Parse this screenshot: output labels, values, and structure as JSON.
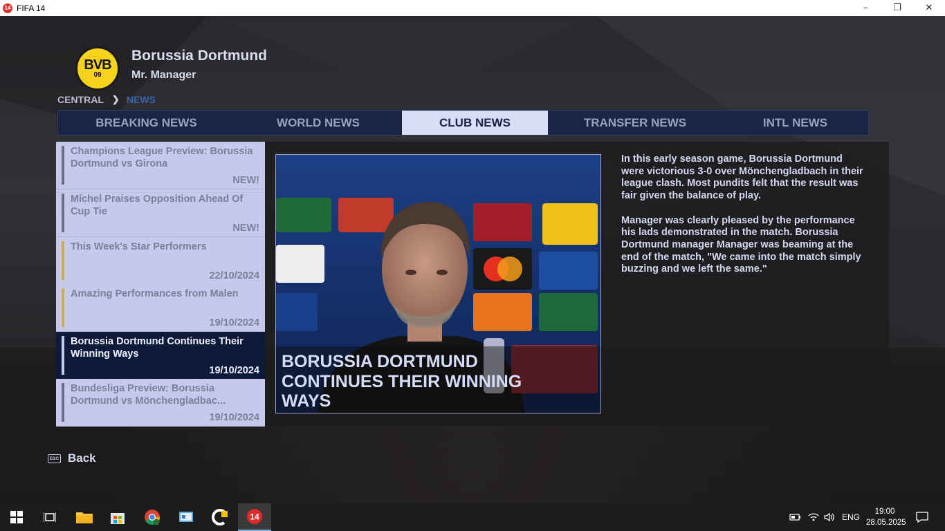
{
  "window": {
    "app_icon_text": "14",
    "title": "FIFA 14",
    "controls": {
      "minimize": "–",
      "maximize": "❐",
      "close": "✕"
    }
  },
  "header": {
    "crest_text": "BVB",
    "crest_year": "09",
    "club_name": "Borussia Dortmund",
    "manager_name": "Mr. Manager"
  },
  "breadcrumb": {
    "central": "CENTRAL",
    "separator": "❯",
    "current": "NEWS"
  },
  "tabs": [
    {
      "label": "BREAKING NEWS",
      "active": false
    },
    {
      "label": "WORLD NEWS",
      "active": false
    },
    {
      "label": "CLUB NEWS",
      "active": true
    },
    {
      "label": "TRANSFER NEWS",
      "active": false
    },
    {
      "label": "INTL NEWS",
      "active": false
    }
  ],
  "news_items": [
    {
      "headline": "Champions League Preview: Borussia Dortmund vs Girona",
      "date": "NEW!",
      "bar": "gray",
      "selected": false
    },
    {
      "headline": " Míchel Praises Opposition Ahead Of Cup Tie",
      "date": "NEW!",
      "bar": "gray",
      "selected": false
    },
    {
      "headline": "This Week's Star Performers",
      "date": "22/10/2024",
      "bar": "gold",
      "selected": false
    },
    {
      "headline": "Amazing Performances from Malen",
      "date": "19/10/2024",
      "bar": "gold",
      "selected": false
    },
    {
      "headline": "Borussia Dortmund Continues Their Winning Ways",
      "date": "19/10/2024",
      "bar": "light",
      "selected": true
    },
    {
      "headline": "Bundesliga Preview: Borussia Dortmund vs Mönchengladbac...",
      "date": "19/10/2024",
      "bar": "gray",
      "selected": false
    }
  ],
  "article": {
    "photo_caption": "BORUSSIA DORTMUND CONTINUES THEIR WINNING WAYS",
    "paragraphs": [
      "In this early season game, Borussia Dortmund were victorious 3-0 over Mönchengladbach in their league clash. Most pundits felt that the result was fair given the balance of play.",
      "Manager was clearly pleased by the performance his lads demonstrated in the match. Borussia Dortmund manager Manager was beaming at the end of the match, \"We came into the match simply buzzing and we left the same.\""
    ]
  },
  "footer": {
    "esc_key": "ESC",
    "back_label": "Back"
  },
  "taskbar": {
    "icons": [
      "windows-start-icon",
      "task-view-icon",
      "file-explorer-icon",
      "microsoft-store-icon",
      "chrome-icon",
      "control-panel-icon",
      "fc-manager-icon",
      "fifa14-icon"
    ],
    "language": "ENG",
    "time": "19:00",
    "date": "28.05.2025"
  },
  "colors": {
    "tab_bar": "#1a2445",
    "tab_active": "#d9dcf7",
    "list_item": "#c6c9ec",
    "list_selected": "#0e1a3a",
    "breadcrumb_current": "#3d63a8",
    "gold_accent": "#c9b23c"
  }
}
